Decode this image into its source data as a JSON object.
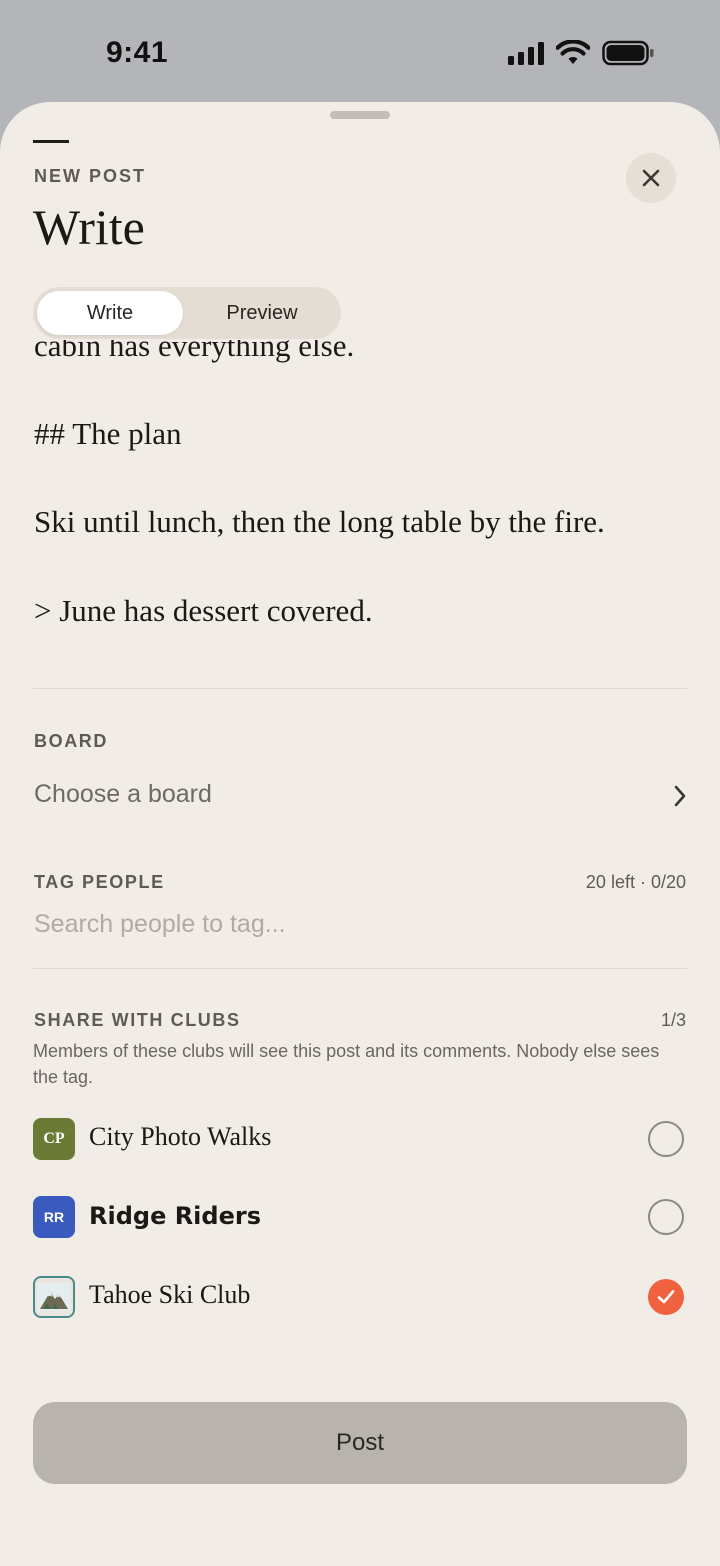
{
  "status_bar": {
    "time": "9:41"
  },
  "sheet": {
    "eyebrow": "NEW POST",
    "title": "Write",
    "tabs": [
      {
        "label": "Write",
        "selected": true
      },
      {
        "label": "Preview",
        "selected": false
      }
    ]
  },
  "editor": {
    "lines": [
      "cabin has everything else.",
      "## The plan",
      "Ski until lunch, then the long table by the fire.",
      "> June has dessert covered."
    ]
  },
  "board": {
    "label": "BOARD",
    "placeholder": "Choose a board"
  },
  "tag_people": {
    "label": "TAG PEOPLE",
    "counter": "20 left · 0/20",
    "placeholder": "Search people to tag..."
  },
  "share_with_clubs": {
    "label": "SHARE WITH CLUBS",
    "counter": "1/3",
    "description": "Members of these clubs will see this post and its comments. Nobody else sees the tag.",
    "clubs": [
      {
        "initials": "CP",
        "name": "City Photo Walks",
        "color": "#6b7a34",
        "selected": false
      },
      {
        "initials": "RR",
        "name": "Ridge Riders",
        "color": "#3a5bbd",
        "selected": false
      },
      {
        "initials": "",
        "name": "Tahoe Ski Club",
        "icon": "mountain-icon",
        "color": "#4b8a8a",
        "selected": true
      }
    ]
  },
  "post_button": {
    "label": "Post"
  },
  "colors": {
    "sheet_bg": "#f1ede6",
    "accent_check": "#f06140",
    "post_button_bg": "#b8b3ad"
  }
}
